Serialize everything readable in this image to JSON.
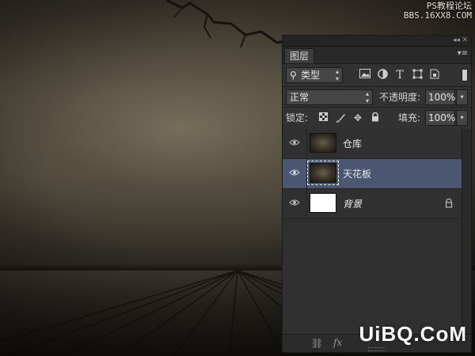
{
  "watermark": {
    "top_line1": "PS教程论坛",
    "top_line2": "BBS.16XX8.COM",
    "bottom": "UiBQ.CoM"
  },
  "panel": {
    "tab_label": "图层",
    "filter": {
      "kind_label": "类型",
      "icons": [
        "image-filter-icon",
        "adjustment-filter-icon",
        "type-filter-icon",
        "shape-filter-icon",
        "smart-object-filter-icon"
      ],
      "type_glyph": "T"
    },
    "blend_mode": "正常",
    "opacity_label": "不透明度:",
    "opacity_value": "100%",
    "lock_label": "锁定:",
    "fill_label": "填充:",
    "fill_value": "100%",
    "layers": [
      {
        "name": "仓库",
        "selected": false,
        "thumb": "dark",
        "locked": false
      },
      {
        "name": "天花板",
        "selected": true,
        "thumb": "dark",
        "locked": false
      },
      {
        "name": "背景",
        "selected": false,
        "thumb": "white",
        "locked": true
      }
    ],
    "footer": {
      "fx_label": "fx"
    }
  },
  "colors": {
    "panel_bg": "#323232",
    "selected_layer": "#4b5670",
    "scene_wall": "#514a3d",
    "scene_floor": "#2a2721"
  }
}
